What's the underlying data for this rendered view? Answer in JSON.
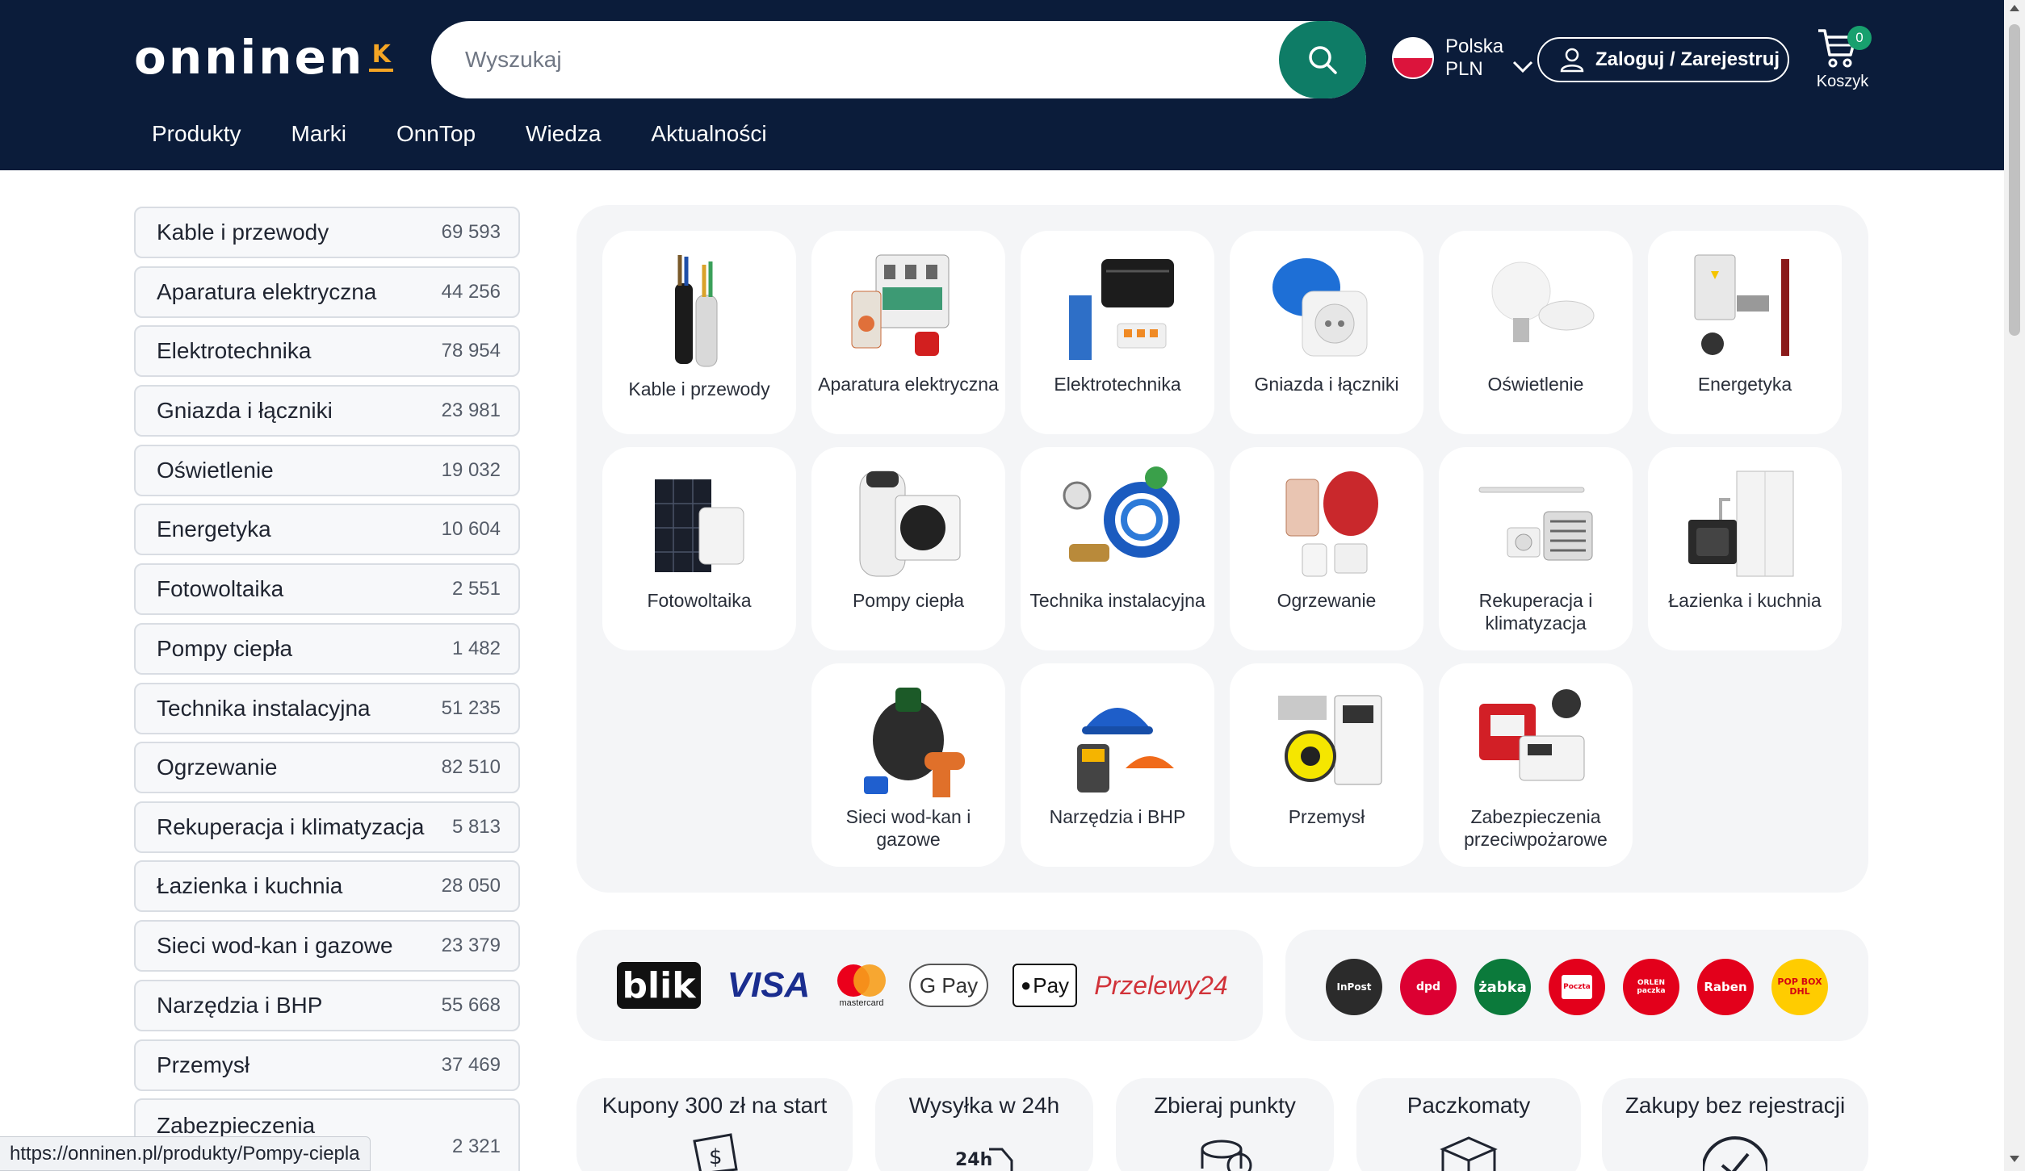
{
  "header": {
    "logo": "onninen",
    "logo_mark": "K",
    "search_placeholder": "Wyszukaj",
    "locale_country": "Polska",
    "locale_currency": "PLN",
    "login_label": "Zaloguj / Zarejestruj",
    "cart_count": "0",
    "cart_label": "Koszyk",
    "nav": [
      "Produkty",
      "Marki",
      "OnnTop",
      "Wiedza",
      "Aktualności"
    ]
  },
  "sidebar": [
    {
      "name": "Kable i przewody",
      "count": "69 593"
    },
    {
      "name": "Aparatura elektryczna",
      "count": "44 256"
    },
    {
      "name": "Elektrotechnika",
      "count": "78 954"
    },
    {
      "name": "Gniazda i łączniki",
      "count": "23 981"
    },
    {
      "name": "Oświetlenie",
      "count": "19 032"
    },
    {
      "name": "Energetyka",
      "count": "10 604"
    },
    {
      "name": "Fotowoltaika",
      "count": "2 551"
    },
    {
      "name": "Pompy ciepła",
      "count": "1 482"
    },
    {
      "name": "Technika instalacyjna",
      "count": "51 235"
    },
    {
      "name": "Ogrzewanie",
      "count": "82 510"
    },
    {
      "name": "Rekuperacja i klimatyzacja",
      "count": "5 813"
    },
    {
      "name": "Łazienka i kuchnia",
      "count": "28 050"
    },
    {
      "name": "Sieci wod-kan i gazowe",
      "count": "23 379"
    },
    {
      "name": "Narzędzia i BHP",
      "count": "55 668"
    },
    {
      "name": "Przemysł",
      "count": "37 469"
    },
    {
      "name": "Zabezpieczenia",
      "count": "2 321"
    }
  ],
  "categories": [
    {
      "label": "Kable i przewody",
      "icon": "cables-icon"
    },
    {
      "label": "Aparatura elektryczna",
      "icon": "circuit-breaker-icon"
    },
    {
      "label": "Elektrotechnika",
      "icon": "electrotechnics-icon"
    },
    {
      "label": "Gniazda i łączniki",
      "icon": "socket-icon"
    },
    {
      "label": "Oświetlenie",
      "icon": "bulb-icon"
    },
    {
      "label": "Energetyka",
      "icon": "energy-icon"
    },
    {
      "label": "Fotowoltaika",
      "icon": "solar-panel-icon"
    },
    {
      "label": "Pompy ciepła",
      "icon": "heat-pump-icon"
    },
    {
      "label": "Technika instalacyjna",
      "icon": "pipes-icon"
    },
    {
      "label": "Ogrzewanie",
      "icon": "heating-icon"
    },
    {
      "label": "Rekuperacja i klimatyzacja",
      "icon": "air-conditioner-icon"
    },
    {
      "label": "Łazienka i kuchnia",
      "icon": "bathroom-icon"
    },
    {
      "label": "Sieci wod-kan i gazowe",
      "icon": "water-network-icon"
    },
    {
      "label": "Narzędzia i BHP",
      "icon": "tools-icon"
    },
    {
      "label": "Przemysł",
      "icon": "industry-icon"
    },
    {
      "label": "Zabezpieczenia przeciwpożarowe",
      "icon": "fire-protection-icon"
    }
  ],
  "payments": [
    "blik",
    "VISA",
    "mastercard",
    "G Pay",
    "Pay",
    "Przelewy24"
  ],
  "shipping": [
    "InPost",
    "dpd",
    "żabka",
    "Poczta",
    "ORLEN paczka",
    "Raben",
    "POP BOX DHL"
  ],
  "benefits": [
    "Kupony 300 zł na start",
    "Wysyłka w 24h",
    "Zbieraj punkty",
    "Paczkomaty",
    "Zakupy bez rejestracji"
  ],
  "benefit_icon_text": "24h",
  "status_url": "https://onninen.pl/produkty/Pompy-ciepla",
  "colors": {
    "header_bg": "#0b1c3a",
    "accent": "#0e7c66",
    "logo_accent": "#f5a524",
    "panel_bg": "#f4f5f7"
  }
}
